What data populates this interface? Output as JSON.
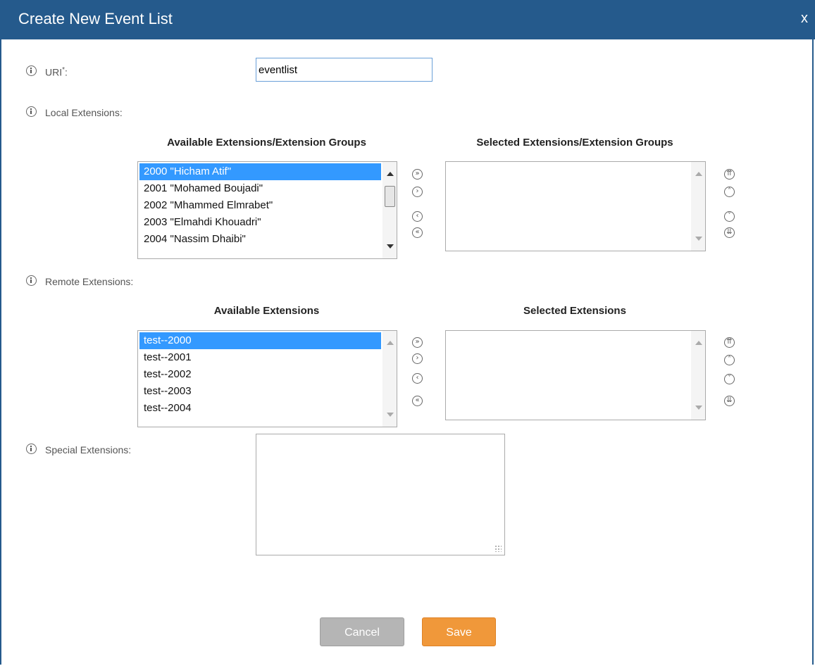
{
  "dialog": {
    "title": "Create New Event List",
    "close_label": "x"
  },
  "uri": {
    "label": "URI",
    "required_mark": "*",
    "suffix": ":",
    "value": "eventlist"
  },
  "local": {
    "label": "Local Extensions:",
    "available_header": "Available Extensions/Extension Groups",
    "selected_header": "Selected Extensions/Extension Groups",
    "available_items": [
      "2000 \"Hicham Atif\"",
      "2001 \"Mohamed Boujadi\"",
      "2002 \"Mhammed Elmrabet\"",
      "2003 \"Elmahdi Khouadri\"",
      "2004 \"Nassim Dhaibi\""
    ],
    "selected_items": []
  },
  "remote": {
    "label": "Remote Extensions:",
    "available_header": "Available Extensions",
    "selected_header": "Selected Extensions",
    "available_items": [
      "test--2000",
      "test--2001",
      "test--2002",
      "test--2003",
      "test--2004"
    ],
    "selected_items": []
  },
  "special": {
    "label": "Special Extensions:",
    "value": ""
  },
  "transfer_buttons": {
    "add_all": "»",
    "add": "›",
    "remove": "‹",
    "remove_all": "«"
  },
  "order_buttons": {
    "top": "⇈",
    "up": "˄",
    "down": "˅",
    "bottom": "⇊"
  },
  "buttons": {
    "cancel": "Cancel",
    "save": "Save"
  },
  "colors": {
    "titlebar": "#255a8c",
    "selection": "#3399ff",
    "save": "#f0983a",
    "cancel": "#b5b5b5"
  }
}
